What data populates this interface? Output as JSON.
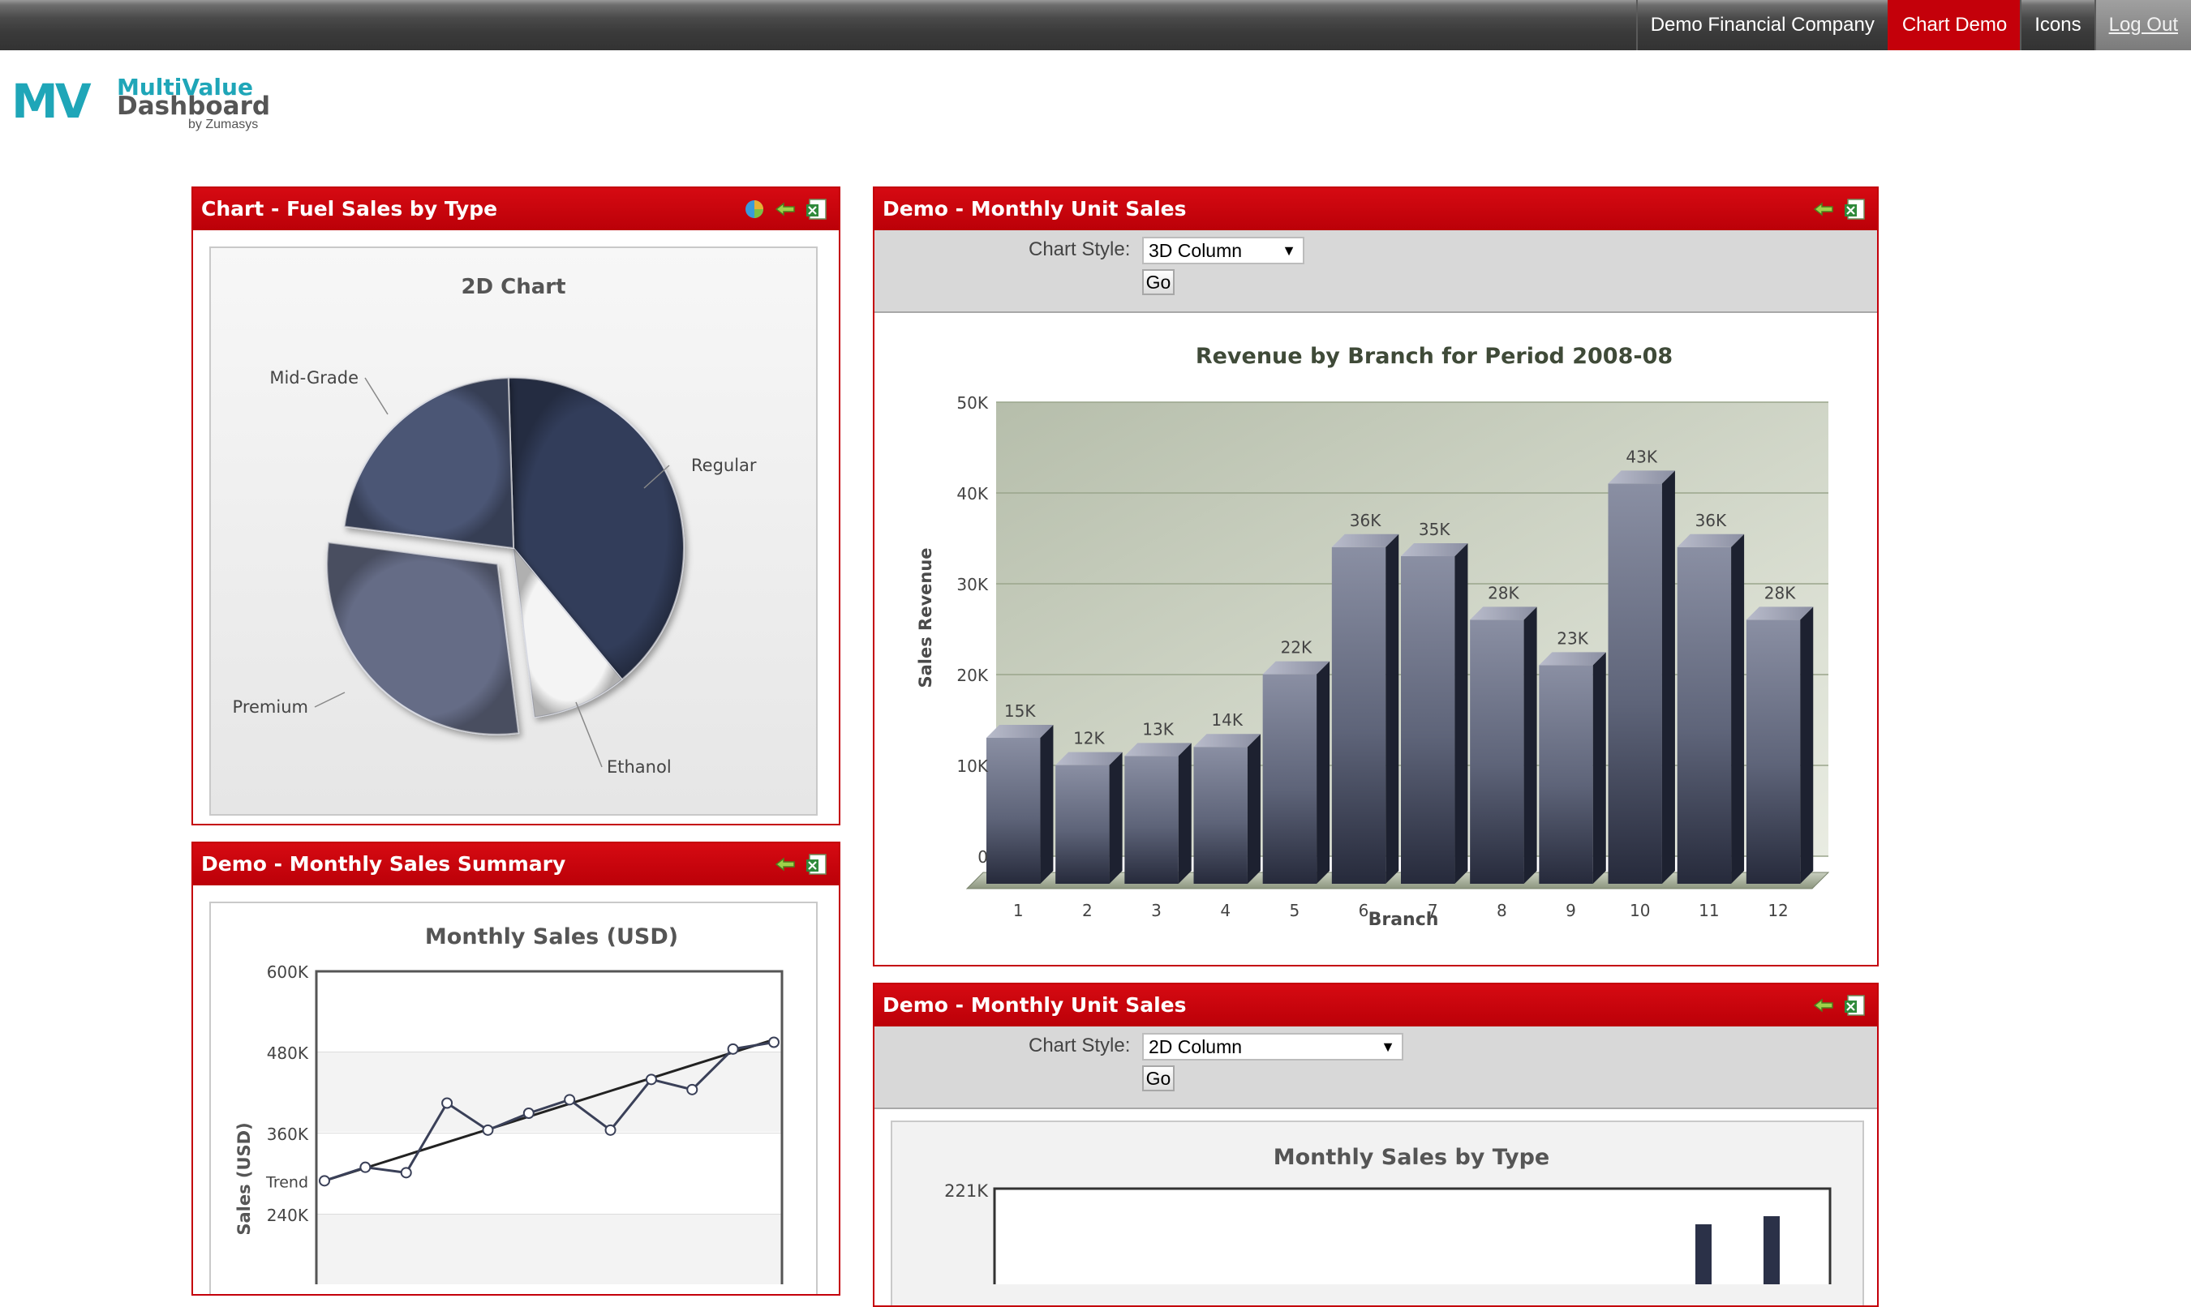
{
  "topnav": {
    "company": "Demo Financial Company",
    "chart_demo": "Chart Demo",
    "icons": "Icons",
    "logout": "Log Out"
  },
  "logo": {
    "mark": "MV",
    "line1": "MultiValue",
    "line2": "Dashboard",
    "line3": "by Zumasys"
  },
  "panels": {
    "fuel": {
      "title": "Chart - Fuel Sales by Type",
      "icons": [
        "pie-chart-icon",
        "back-arrow-icon",
        "excel-export-icon"
      ]
    },
    "summary": {
      "title": "Demo - Monthly Sales Summary",
      "icons": [
        "back-arrow-icon",
        "excel-export-icon"
      ]
    },
    "unit1": {
      "title": "Demo - Monthly Unit Sales",
      "style_label": "Chart Style:",
      "style_value": "3D Column",
      "go_label": "Go",
      "icons": [
        "back-arrow-icon",
        "excel-export-icon"
      ]
    },
    "unit2": {
      "title": "Demo - Monthly Unit Sales",
      "style_label": "Chart Style:",
      "style_value": "2D Column",
      "go_label": "Go",
      "icons": [
        "back-arrow-icon",
        "excel-export-icon"
      ]
    }
  },
  "colors": {
    "header_red": "#c4000a",
    "bar_navy": "#5a6078",
    "pie_regular": "#333d5a",
    "pie_midgrade": "#4b5675",
    "pie_premium": "#656c86",
    "pie_ethanol": "#f4f4f4"
  },
  "chart_data": [
    {
      "id": "fuel",
      "type": "pie",
      "title": "2D Chart",
      "slices": [
        {
          "label": "Regular",
          "value": 39.5
        },
        {
          "label": "Ethanol",
          "value": 9
        },
        {
          "label": "Premium",
          "value": 29
        },
        {
          "label": "Mid-Grade",
          "value": 22.5
        }
      ],
      "exploded": [
        "Premium"
      ]
    },
    {
      "id": "revenue",
      "type": "bar",
      "style": "3D Column",
      "title": "Revenue by Branch for Period 2008-08",
      "xlabel": "Branch",
      "ylabel": "Sales Revenue",
      "categories": [
        "1",
        "2",
        "3",
        "4",
        "5",
        "6",
        "7",
        "8",
        "9",
        "10",
        "11",
        "12"
      ],
      "values": [
        15000,
        12000,
        13000,
        14000,
        22000,
        36000,
        35000,
        28000,
        23000,
        43000,
        36000,
        28000
      ],
      "data_labels": [
        "15K",
        "12K",
        "13K",
        "14K",
        "22K",
        "36K",
        "35K",
        "28K",
        "23K",
        "43K",
        "36K",
        "28K"
      ],
      "ylim": [
        0,
        50000
      ],
      "yticks": [
        "0",
        "10K",
        "20K",
        "30K",
        "40K",
        "50K"
      ],
      "grid": true
    },
    {
      "id": "monthly",
      "type": "line",
      "title": "Monthly Sales (USD)",
      "ylabel": "Sales (USD)",
      "ylim": [
        120000,
        600000
      ],
      "yticks": [
        "600K",
        "480K",
        "360K",
        "240K"
      ],
      "series": [
        {
          "values": [
            290000,
            310000,
            302000,
            405000,
            365000,
            390000,
            410000,
            365000,
            440000,
            425000,
            485000,
            495000
          ]
        },
        {
          "name": "Trend",
          "values": [
            290000,
            309000,
            328000,
            347000,
            366000,
            385000,
            404000,
            423000,
            442000,
            461000,
            480000,
            499000
          ]
        }
      ],
      "grid": true
    },
    {
      "id": "bytype",
      "type": "bar",
      "style": "2D Column",
      "title": "Monthly Sales by Type",
      "yticks": [
        "221K"
      ],
      "grid": false
    }
  ]
}
